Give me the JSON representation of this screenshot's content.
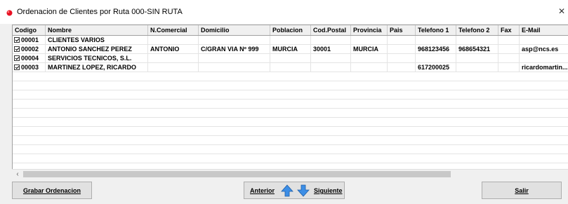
{
  "window": {
    "title": "Ordenacion de Clientes por Ruta 000-SIN RUTA",
    "close_glyph": "✕",
    "accent_color": "#e81123"
  },
  "grid": {
    "columns": [
      "Codigo",
      "Nombre",
      "N.Comercial",
      "Domicilio",
      "Poblacion",
      "Cod.Postal",
      "Provincia",
      "Pais",
      "Telefono 1",
      "Telefono 2",
      "Fax",
      "E-Mail"
    ],
    "rows": [
      {
        "checked": true,
        "codigo": "00001",
        "nombre": "CLIENTES VARIOS",
        "comercial": "",
        "domicilio": "",
        "poblacion": "",
        "cp": "",
        "provincia": "",
        "pais": "",
        "tel1": "",
        "tel2": "",
        "fax": "",
        "email": ""
      },
      {
        "checked": true,
        "codigo": "00002",
        "nombre": "ANTONIO SANCHEZ PEREZ",
        "comercial": "ANTONIO",
        "domicilio": "C/GRAN VIA Nº 999",
        "poblacion": "MURCIA",
        "cp": "30001",
        "provincia": "MURCIA",
        "pais": "",
        "tel1": "968123456",
        "tel2": "968654321",
        "fax": "",
        "email": "asp@ncs.es"
      },
      {
        "checked": true,
        "codigo": "00004",
        "nombre": "SERVICIOS TECNICOS, S.L.",
        "comercial": "",
        "domicilio": "",
        "poblacion": "",
        "cp": "",
        "provincia": "",
        "pais": "",
        "tel1": "",
        "tel2": "",
        "fax": "",
        "email": ""
      },
      {
        "checked": true,
        "codigo": "00003",
        "nombre": "MARTINEZ LOPEZ, RICARDO",
        "comercial": "",
        "domicilio": "",
        "poblacion": "",
        "cp": "",
        "provincia": "",
        "pais": "",
        "tel1": "617200025",
        "tel2": "",
        "fax": "",
        "email": "ricardomartin..."
      }
    ]
  },
  "scrollbar": {
    "left_glyph": "‹"
  },
  "buttons": {
    "save": "Grabar Ordenacion",
    "prev": "Anterior",
    "next": "Siguiente",
    "exit": "Salir"
  },
  "icons": {
    "up": "arrow-up-icon",
    "down": "arrow-down-icon",
    "app": "app-icon"
  }
}
